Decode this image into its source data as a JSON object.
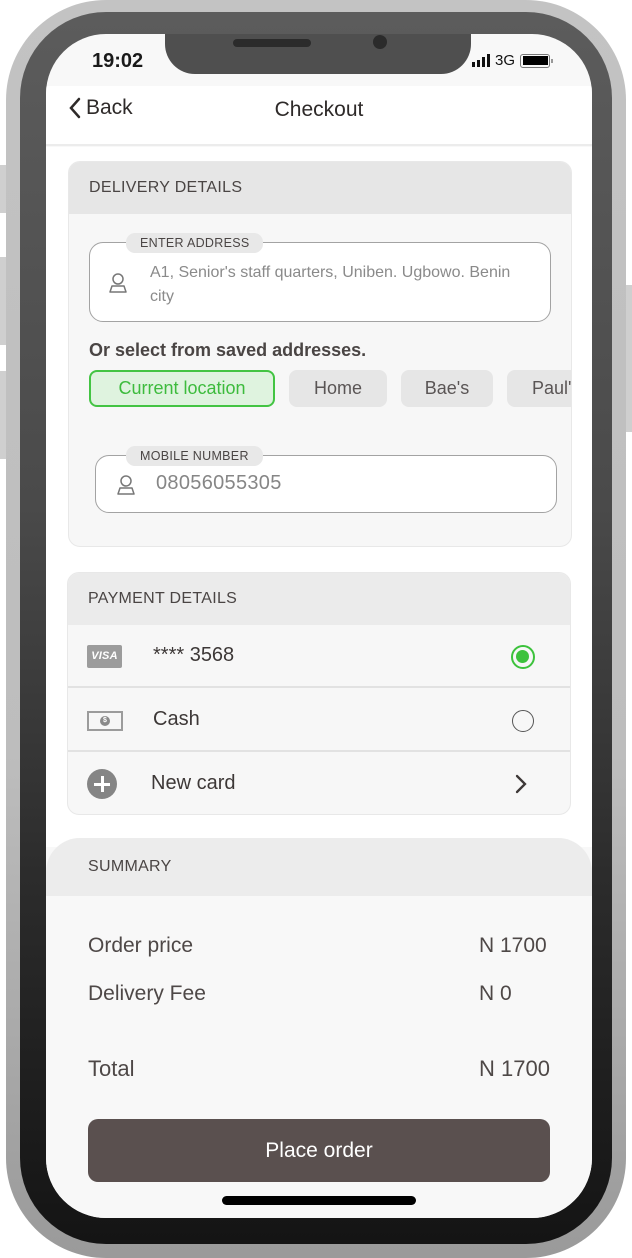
{
  "status_bar": {
    "time": "19:02",
    "network": "3G",
    "battery_level": 1.0
  },
  "header": {
    "back_label": "Back",
    "title": "Checkout"
  },
  "delivery": {
    "section_title": "DELIVERY DETAILS",
    "address_label": "ENTER ADDRESS",
    "address_value": "A1, Senior's staff quarters, Uniben. Ugbowo. Benin city",
    "saved_prompt": "Or select from saved addresses.",
    "saved_addresses": [
      {
        "label": "Current location",
        "selected": true
      },
      {
        "label": "Home",
        "selected": false
      },
      {
        "label": "Bae's",
        "selected": false
      },
      {
        "label": "Paul's",
        "selected": false
      }
    ],
    "mobile_label": "MOBILE NUMBER",
    "mobile_value": "08056055305"
  },
  "payment": {
    "section_title": "PAYMENT DETAILS",
    "methods": [
      {
        "icon": "visa-card-icon",
        "icon_text": "VISA",
        "label": "**** 3568",
        "selected": true
      },
      {
        "icon": "cash-icon",
        "icon_text": "$",
        "label": "Cash",
        "selected": false
      },
      {
        "icon": "plus-circle-icon",
        "label": "New card",
        "action": "chevron-right-icon"
      }
    ]
  },
  "summary": {
    "section_title": "SUMMARY",
    "rows": [
      {
        "label": "Order price",
        "value": "N 1700"
      },
      {
        "label": "Delivery Fee",
        "value": "N 0"
      },
      {
        "label": "Total",
        "value": "N 1700"
      }
    ]
  },
  "actions": {
    "place_order_label": "Place order"
  },
  "colors": {
    "accent_green": "#3cc23c",
    "primary_button": "#5a504f",
    "text_dark": "#4a4544"
  }
}
